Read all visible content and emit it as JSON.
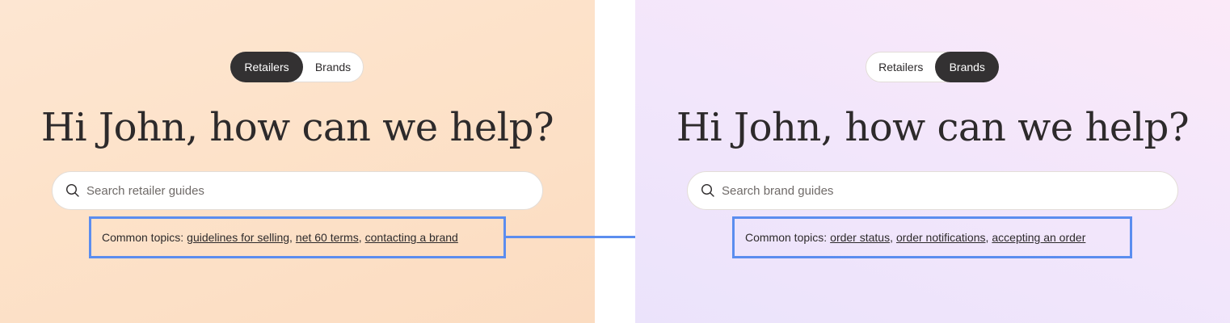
{
  "left_panel": {
    "toggle": {
      "option1": "Retailers",
      "option2": "Brands",
      "active": "Retailers"
    },
    "headline": "Hi John, how can we help?",
    "search": {
      "placeholder": "Search retailer guides",
      "icon": "search-icon"
    },
    "topics": {
      "label": "Common topics:",
      "links": [
        "guidelines for selling",
        "net 60 terms",
        "contacting a brand"
      ]
    },
    "background_color": "#fde2c9"
  },
  "right_panel": {
    "toggle": {
      "option1": "Retailers",
      "option2": "Brands",
      "active": "Brands"
    },
    "headline": "Hi John, how can we help?",
    "search": {
      "placeholder": "Search brand guides",
      "icon": "search-icon"
    },
    "topics": {
      "label": "Common topics:",
      "links": [
        "order status",
        "order notifications",
        "accepting an order"
      ]
    },
    "background_color": "#f2e6fb"
  },
  "colors": {
    "active_toggle": "#333132",
    "highlight_outline": "#5b8def",
    "text": "#2d2a2b"
  },
  "separators": {
    "comma": ","
  }
}
